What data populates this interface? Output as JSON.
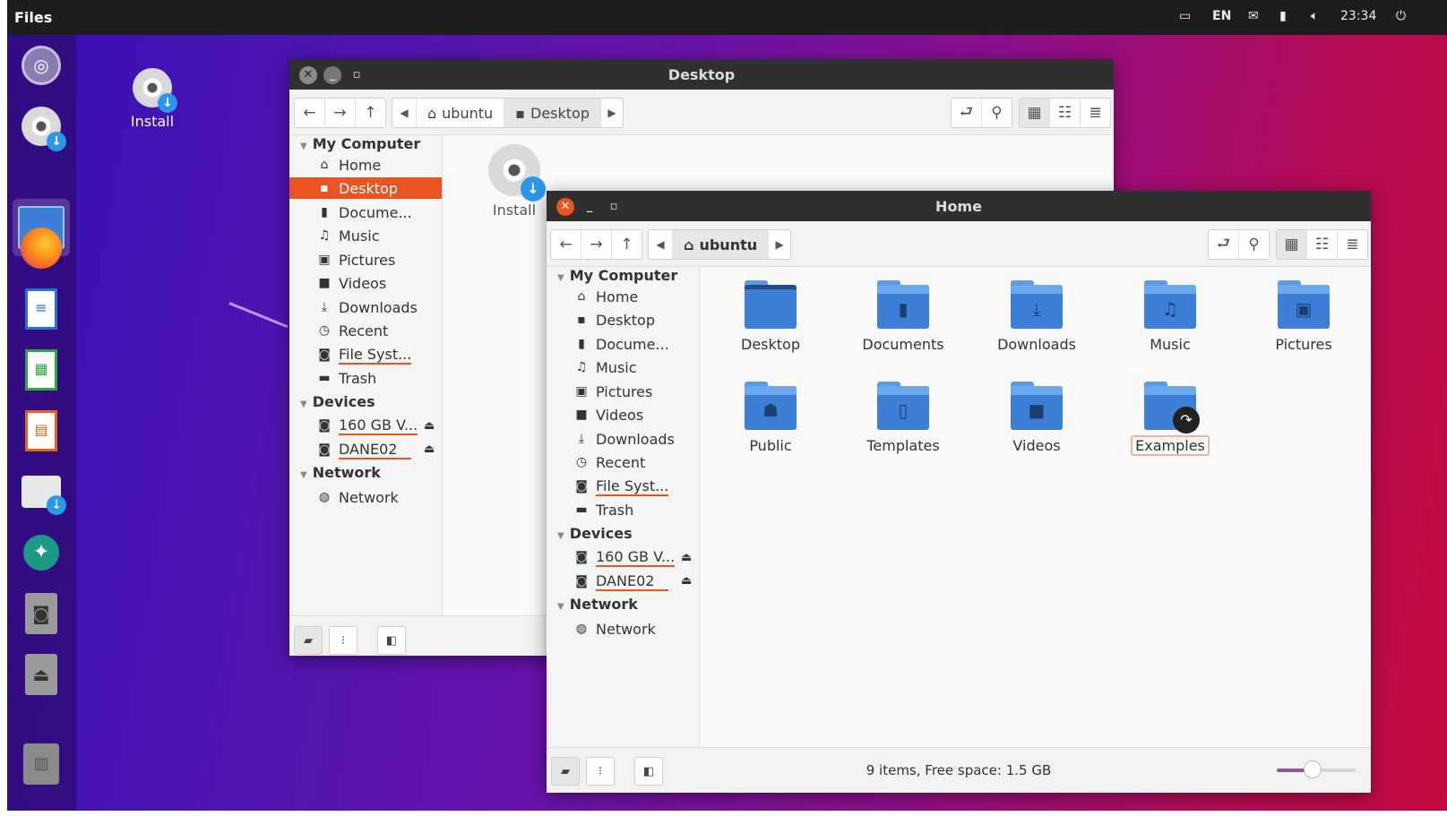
{
  "topbar": {
    "app": "Files",
    "lang": "EN",
    "clock": "23:34"
  },
  "desktop": {
    "install_label": "Install"
  },
  "back_window": {
    "title": "Desktop",
    "breadcrumbs": [
      "ubuntu",
      "Desktop"
    ],
    "content_install": "Install",
    "sidebar": {
      "my_computer": "My Computer",
      "items": [
        "Home",
        "Desktop",
        "Docume...",
        "Music",
        "Pictures",
        "Videos",
        "Downloads",
        "Recent",
        "File Syst...",
        "Trash"
      ],
      "devices": "Devices",
      "device_items": [
        "160 GB V...",
        "DANE02"
      ],
      "network": "Network",
      "network_items": [
        "Network"
      ]
    }
  },
  "front_window": {
    "title": "Home",
    "breadcrumbs": [
      "ubuntu"
    ],
    "sidebar": {
      "my_computer": "My Computer",
      "items": [
        "Home",
        "Desktop",
        "Docume...",
        "Music",
        "Pictures",
        "Videos",
        "Downloads",
        "Recent",
        "File Syst...",
        "Trash"
      ],
      "devices": "Devices",
      "device_items": [
        "160 GB V...",
        "DANE02"
      ],
      "network": "Network",
      "network_items": [
        "Network"
      ]
    },
    "folders": [
      "Desktop",
      "Documents",
      "Downloads",
      "Music",
      "Pictures",
      "Public",
      "Templates",
      "Videos",
      "Examples"
    ],
    "status": "9 items, Free space: 1.5 GB",
    "zoom_fraction": 0.45
  },
  "colors": {
    "accent": "#e95420",
    "folder": "#3d7fd6",
    "topbar": "#1d1d1d"
  }
}
